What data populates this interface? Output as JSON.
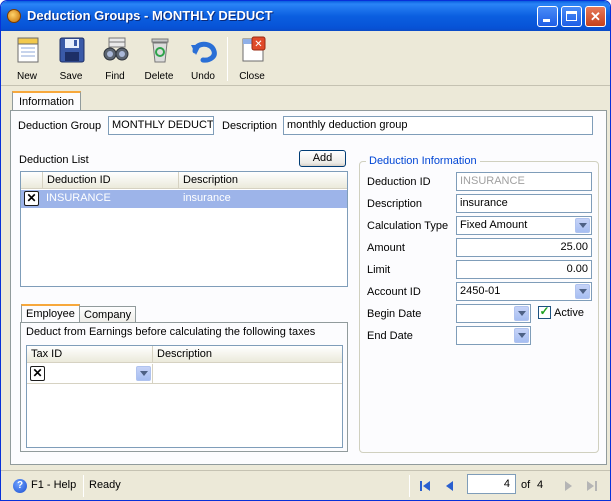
{
  "window": {
    "title": "Deduction Groups - MONTHLY DEDUCT"
  },
  "toolbar": {
    "new": "New",
    "save": "Save",
    "find": "Find",
    "delete": "Delete",
    "undo": "Undo",
    "close": "Close"
  },
  "tabs": {
    "information": "Information"
  },
  "header": {
    "deduction_group_label": "Deduction Group",
    "deduction_group_value": "MONTHLY DEDUCT",
    "description_label": "Description",
    "description_value": "monthly deduction group"
  },
  "deduction_list": {
    "label": "Deduction List",
    "add_button": "Add",
    "columns": [
      "Deduction ID",
      "Description"
    ],
    "rows": [
      {
        "id": "INSURANCE",
        "description": "insurance"
      }
    ]
  },
  "subtabs": {
    "employee": "Employee",
    "company": "Company",
    "employee_caption": "Deduct from Earnings before calculating the following taxes",
    "columns": [
      "Tax ID",
      "Description"
    ]
  },
  "deduction_info": {
    "title": "Deduction Information",
    "deduction_id_label": "Deduction ID",
    "deduction_id_value": "INSURANCE",
    "description_label": "Description",
    "description_value": "insurance",
    "calc_type_label": "Calculation Type",
    "calc_type_value": "Fixed Amount",
    "amount_label": "Amount",
    "amount_value": "25.00",
    "limit_label": "Limit",
    "limit_value": "0.00",
    "account_id_label": "Account ID",
    "account_id_value": "2450-01",
    "begin_date_label": "Begin Date",
    "begin_date_value": "",
    "active_label": "Active",
    "end_date_label": "End Date",
    "end_date_value": ""
  },
  "status": {
    "help": "F1 - Help",
    "state": "Ready",
    "page_current": "4",
    "page_of": "of",
    "page_total": "4"
  }
}
